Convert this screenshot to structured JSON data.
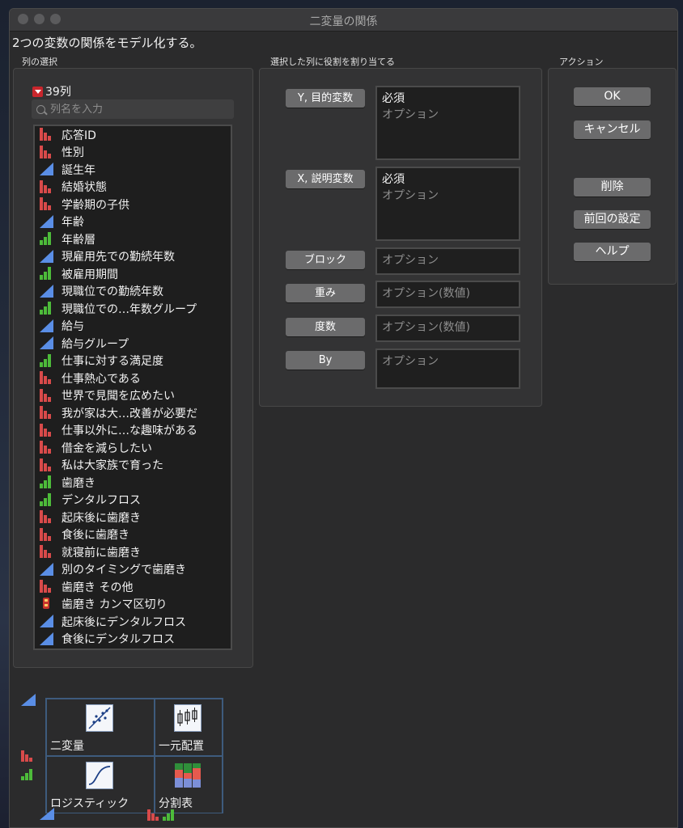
{
  "window": {
    "title": "二変量の関係"
  },
  "subtitle": "2つの変数の関係をモデル化する。",
  "column_select": {
    "label": "列の選択",
    "count": "39列",
    "search_placeholder": "列名を入力",
    "columns": [
      {
        "name": "応答ID",
        "type": "nominal"
      },
      {
        "name": "性別",
        "type": "nominal"
      },
      {
        "name": "誕生年",
        "type": "continuous"
      },
      {
        "name": "結婚状態",
        "type": "nominal"
      },
      {
        "name": "学齢期の子供",
        "type": "nominal"
      },
      {
        "name": "年齢",
        "type": "continuous"
      },
      {
        "name": "年齢層",
        "type": "ordinal"
      },
      {
        "name": "現雇用先での勤続年数",
        "type": "continuous"
      },
      {
        "name": "被雇用期間",
        "type": "ordinal"
      },
      {
        "name": "現職位での勤続年数",
        "type": "continuous"
      },
      {
        "name": "現職位での…年数グループ",
        "type": "ordinal"
      },
      {
        "name": "給与",
        "type": "continuous"
      },
      {
        "name": "給与グループ",
        "type": "continuous"
      },
      {
        "name": "仕事に対する満足度",
        "type": "ordinal"
      },
      {
        "name": "仕事熱心である",
        "type": "nominal"
      },
      {
        "name": "世界で見聞を広めたい",
        "type": "nominal"
      },
      {
        "name": "我が家は大…改善が必要だ",
        "type": "nominal"
      },
      {
        "name": "仕事以外に…な趣味がある",
        "type": "nominal"
      },
      {
        "name": "借金を減らしたい",
        "type": "nominal"
      },
      {
        "name": "私は大家族で育った",
        "type": "nominal"
      },
      {
        "name": "歯磨き",
        "type": "ordinal"
      },
      {
        "name": "デンタルフロス",
        "type": "ordinal"
      },
      {
        "name": "起床後に歯磨き",
        "type": "nominal"
      },
      {
        "name": "食後に歯磨き",
        "type": "nominal"
      },
      {
        "name": "就寝前に歯磨き",
        "type": "nominal"
      },
      {
        "name": "別のタイミングで歯磨き",
        "type": "continuous"
      },
      {
        "name": "歯磨き その他",
        "type": "nominal"
      },
      {
        "name": "歯磨き カンマ区切り",
        "type": "multiple"
      },
      {
        "name": "起床後にデンタルフロス",
        "type": "continuous"
      },
      {
        "name": "食後にデンタルフロス",
        "type": "continuous"
      }
    ]
  },
  "roles": {
    "label": "選択した列に役割を割り当てる",
    "y": {
      "button": "Y, 目的変数",
      "required": "必須",
      "optional": "オプション"
    },
    "x": {
      "button": "X, 説明変数",
      "required": "必須",
      "optional": "オプション"
    },
    "block": {
      "button": "ブロック",
      "optional": "オプション"
    },
    "weight": {
      "button": "重み",
      "optional": "オプション(数値)"
    },
    "freq": {
      "button": "度数",
      "optional": "オプション(数値)"
    },
    "by": {
      "button": "By",
      "optional": "オプション"
    }
  },
  "actions": {
    "label": "アクション",
    "ok": "OK",
    "cancel": "キャンセル",
    "remove": "削除",
    "recall": "前回の設定",
    "help": "ヘルプ"
  },
  "platforms": {
    "bivariate": "二変量",
    "oneway": "一元配置",
    "logistic": "ロジスティック",
    "contingency": "分割表"
  },
  "colors": {
    "nominal": "#d84a4a",
    "ordinal": "#4dbb3a",
    "continuous": "#5a8ee6"
  }
}
